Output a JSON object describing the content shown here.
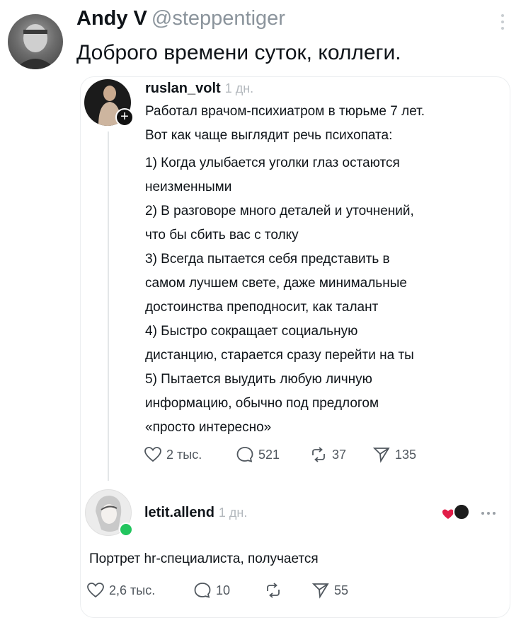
{
  "outer_post": {
    "author_name": "Andy V",
    "author_handle": "@steppentiger",
    "text": "Доброго времени суток, коллеги."
  },
  "quoted_post": {
    "author_name": "ruslan_volt",
    "time": "1 дн.",
    "lines": [
      "Работал врачом-психиатром в тюрьме 7 лет.",
      "Вот как чаще выглядит речь психопата:",
      "1) Когда улыбается уголки глаз остаются",
      "неизменными",
      "2) В разговоре много деталей и уточнений,",
      "что бы сбить вас с толку",
      "3) Всегда пытается себя представить в",
      "самом лучшем свете, даже минимальные",
      "достоинства преподносит, как талант",
      "4) Быстро сокращает социальную",
      "дистанцию, старается сразу перейти на ты",
      "5) Пытается выудить любую личную",
      "информацию, обычно под предлогом",
      "«просто интересно»"
    ],
    "likes": "2 тыс.",
    "replies": "521",
    "reposts": "37",
    "shares": "135"
  },
  "reply_post": {
    "author_name": "letit.allend",
    "time": "1 дн.",
    "text": "Портрет hr-специалиста, получается",
    "likes": "2,6 тыс.",
    "replies": "10",
    "shares": "55"
  },
  "icons": [
    "follow-plus-icon",
    "heart-icon",
    "comment-icon",
    "repost-icon",
    "share-icon",
    "more-icon",
    "online-status-dot"
  ],
  "colors": {
    "online_dot": "#22c55e",
    "muted_text": "#8b949c",
    "reaction_heart": "#e11d48"
  }
}
